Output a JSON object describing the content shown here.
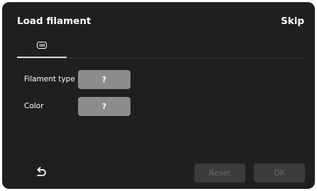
{
  "header": {
    "title": "Load filament",
    "skip_label": "Skip"
  },
  "tabs": [
    {
      "icon": "filament-spool-icon",
      "selected": true
    }
  ],
  "form": {
    "filament_type": {
      "label": "Filament type",
      "value": "?"
    },
    "color": {
      "label": "Color",
      "value": "?"
    }
  },
  "footer": {
    "back_icon": "back-arrow-icon",
    "reset_label": "Reset",
    "ok_label": "OK",
    "reset_enabled": false,
    "ok_enabled": false
  },
  "colors": {
    "background": "#1f1f1f",
    "selector_button": "#8c8c8c",
    "disabled_button": "#3c3c3c",
    "disabled_text": "#6a6a6a"
  }
}
